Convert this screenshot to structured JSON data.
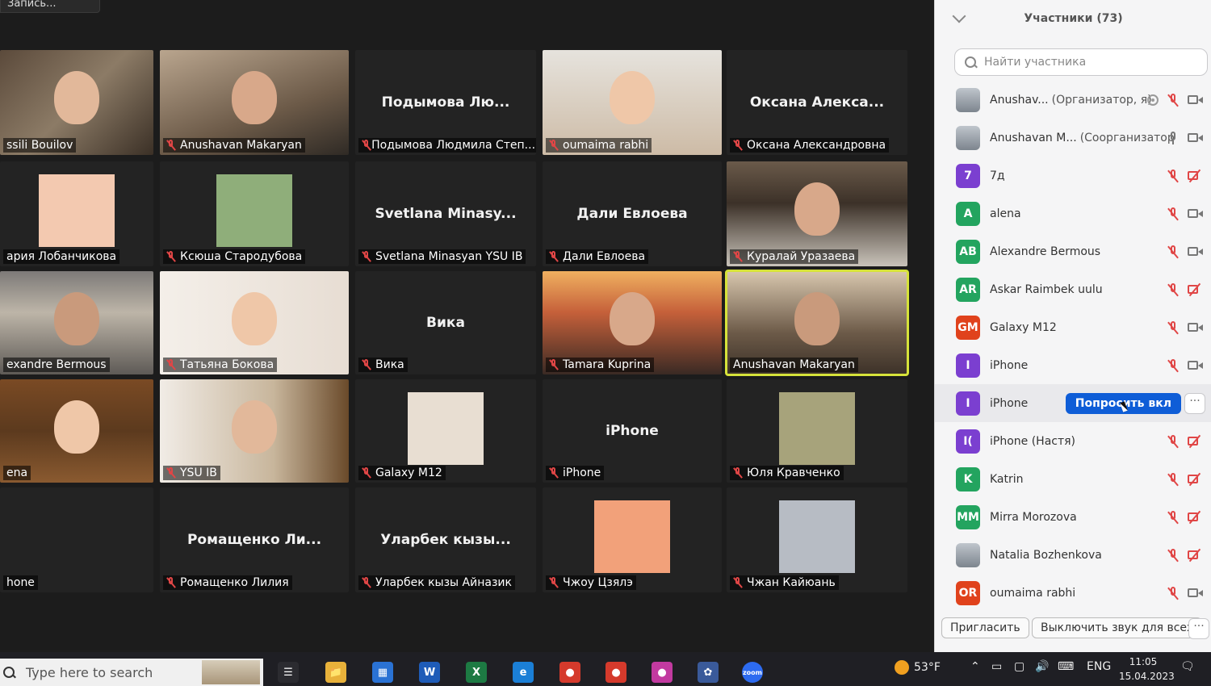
{
  "recording_badge": "Запись...",
  "tiles": [
    {
      "big": "",
      "label": "ssili Bouilov",
      "muted": false,
      "video": true
    },
    {
      "big": "",
      "label": "Anushavan Makaryan",
      "muted": true,
      "video": true
    },
    {
      "big": "Подымова Лю...",
      "label": "Подымова Людмила Степ...",
      "muted": true,
      "video": false
    },
    {
      "big": "",
      "label": "oumaima rabhi",
      "muted": true,
      "video": true
    },
    {
      "big": "Оксана Алекса...",
      "label": "Оксана Александровна",
      "muted": true,
      "video": false
    },
    {
      "big": "",
      "label": "ария Лобанчикова",
      "muted": false,
      "video": false
    },
    {
      "big": "",
      "label": "Ксюша Стародубова",
      "muted": true,
      "video": false
    },
    {
      "big": "Svetlana Minasy...",
      "label": "Svetlana Minasyan YSU IB",
      "muted": true,
      "video": false
    },
    {
      "big": "Дали Евлоева",
      "label": "Дали Евлоева",
      "muted": true,
      "video": false
    },
    {
      "big": "",
      "label": "Куралай Уразаева",
      "muted": true,
      "video": true
    },
    {
      "big": "",
      "label": "exandre Bermous",
      "muted": false,
      "video": true
    },
    {
      "big": "",
      "label": "Татьяна Бокова",
      "muted": true,
      "video": true
    },
    {
      "big": "Вика",
      "label": "Вика",
      "muted": true,
      "video": false
    },
    {
      "big": "",
      "label": "Tamara Kuprina",
      "muted": true,
      "video": true
    },
    {
      "big": "",
      "label": "Anushavan Makaryan",
      "muted": false,
      "video": true
    },
    {
      "big": "",
      "label": "ena",
      "muted": false,
      "video": true
    },
    {
      "big": "",
      "label": "YSU IB",
      "muted": true,
      "video": true
    },
    {
      "big": "",
      "label": "Galaxy M12",
      "muted": true,
      "video": false
    },
    {
      "big": "iPhone",
      "label": "iPhone",
      "muted": true,
      "video": false
    },
    {
      "big": "",
      "label": "Юля Кравченко",
      "muted": true,
      "video": false
    },
    {
      "big": "",
      "label": "hone",
      "muted": false,
      "video": false
    },
    {
      "big": "Ромащенко Ли...",
      "label": "Ромащенко Лилия",
      "muted": true,
      "video": false
    },
    {
      "big": "Уларбек кызы...",
      "label": "Уларбек кызы Айназик",
      "muted": true,
      "video": false
    },
    {
      "big": "",
      "label": "Чжоу Цзялэ",
      "muted": true,
      "video": false
    },
    {
      "big": "",
      "label": "Чжан Кайюань",
      "muted": true,
      "video": false
    }
  ],
  "panel": {
    "title": "Участники (73)",
    "search_placeholder": "Найти участника",
    "participants": [
      {
        "initials": "",
        "color": "",
        "name": "Anushav...",
        "role": "(Организатор, я)",
        "mic": "target-off",
        "cam": "on"
      },
      {
        "initials": "",
        "color": "",
        "name": "Anushavan M...",
        "role": "(Соорганизатор)",
        "mic": "on",
        "cam": "on"
      },
      {
        "initials": "7",
        "color": "#7b3fd0",
        "name": "7д",
        "role": "",
        "mic": "off",
        "cam": "off"
      },
      {
        "initials": "A",
        "color": "#23a45f",
        "name": "alena",
        "role": "",
        "mic": "off",
        "cam": "on"
      },
      {
        "initials": "AB",
        "color": "#23a45f",
        "name": "Alexandre Bermous",
        "role": "",
        "mic": "off",
        "cam": "on"
      },
      {
        "initials": "AR",
        "color": "#23a45f",
        "name": "Askar Raimbek uulu",
        "role": "",
        "mic": "off",
        "cam": "off"
      },
      {
        "initials": "GM",
        "color": "#e0421c",
        "name": "Galaxy M12",
        "role": "",
        "mic": "off",
        "cam": "on"
      },
      {
        "initials": "I",
        "color": "#7b3fd0",
        "name": "iPhone",
        "role": "",
        "mic": "off",
        "cam": "on"
      },
      {
        "initials": "I",
        "color": "#7b3fd0",
        "name": "iPhone",
        "role": "",
        "mic": "",
        "cam": "",
        "hover": true
      },
      {
        "initials": "I(",
        "color": "#7b3fd0",
        "name": "iPhone (Настя)",
        "role": "",
        "mic": "off",
        "cam": "off"
      },
      {
        "initials": "K",
        "color": "#23a45f",
        "name": "Katrin",
        "role": "",
        "mic": "off",
        "cam": "off"
      },
      {
        "initials": "MM",
        "color": "#23a45f",
        "name": "Mirra Morozova",
        "role": "",
        "mic": "off",
        "cam": "off"
      },
      {
        "initials": "",
        "color": "",
        "name": "Natalia Bozhenkova",
        "role": "",
        "mic": "off",
        "cam": "off"
      },
      {
        "initials": "OR",
        "color": "#e0421c",
        "name": "oumaima rabhi",
        "role": "",
        "mic": "off",
        "cam": "on"
      }
    ],
    "ask_button": "Попросить вкл",
    "more": "···",
    "invite_button": "Пригласить",
    "mute_all_button": "Выключить звук для всех"
  },
  "taskbar": {
    "search_placeholder": "Type here to search",
    "apps": [
      {
        "label": "☰",
        "color": "#2b2b30"
      },
      {
        "label": "📁",
        "color": "#e8b13a"
      },
      {
        "label": "▦",
        "color": "#2a72d4"
      },
      {
        "label": "W",
        "color": "#1f5cb8"
      },
      {
        "label": "X",
        "color": "#1d7a43"
      },
      {
        "label": "e",
        "color": "#1b7fd6"
      },
      {
        "label": "●",
        "color": "#d53a2c"
      },
      {
        "label": "●",
        "color": "#d53a2c"
      },
      {
        "label": "●",
        "color": "#c23aa0"
      },
      {
        "label": "✿",
        "color": "#3a5a9a"
      },
      {
        "label": "zoom",
        "color": "#2d6bf0"
      }
    ],
    "weather": "53°F",
    "language": "ENG",
    "time": "11:05",
    "date": "15.04.2023"
  }
}
